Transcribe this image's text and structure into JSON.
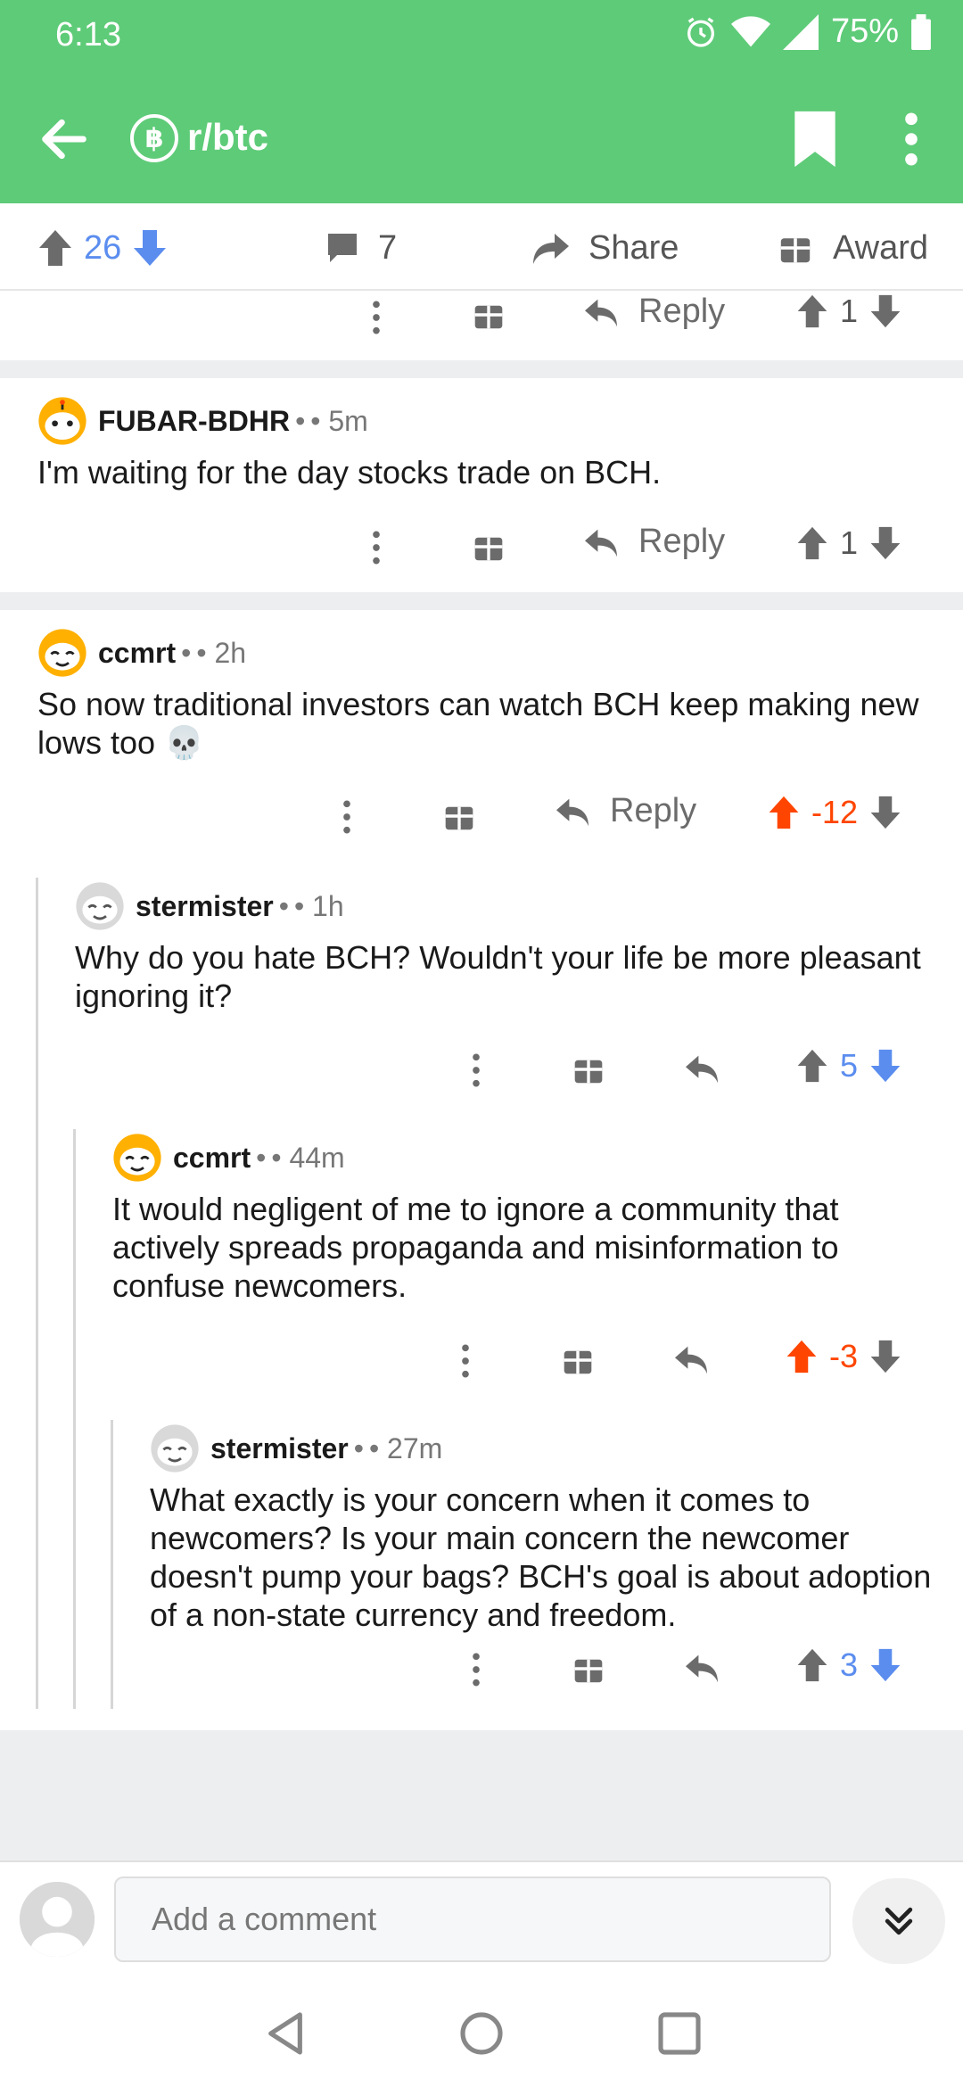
{
  "status": {
    "time": "6:13",
    "battery": "75%"
  },
  "header": {
    "subreddit": "r/btc",
    "sub_icon_glyph": "฿"
  },
  "post_actions": {
    "score": "26",
    "comments": "7",
    "share": "Share",
    "award": "Award"
  },
  "top_partial": {
    "reply": "Reply",
    "score": "1"
  },
  "comments": [
    {
      "author": "FUBAR-BDHR",
      "dot": "•",
      "time": "• 5m",
      "body": "I'm waiting for the day stocks trade on BCH.",
      "reply": "Reply",
      "score": "1",
      "vote_state": "none"
    },
    {
      "author": "ccmrt",
      "dot": "•",
      "time": "• 2h",
      "body": "So now traditional investors can watch BCH keep making new lows too 💀",
      "reply": "Reply",
      "score": "-12",
      "vote_state": "up"
    },
    {
      "author": "stermister",
      "dot": "•",
      "time": "• 1h",
      "body": "Why do you hate BCH? Wouldn't your life be more pleasant ignoring it?",
      "score": "5",
      "vote_state": "down"
    },
    {
      "author": "ccmrt",
      "dot": "•",
      "time": "• 44m",
      "body": "It would negligent of me to ignore a community that actively spreads propaganda and misinformation to confuse newcomers.",
      "score": "-3",
      "vote_state": "up"
    },
    {
      "author": "stermister",
      "dot": "•",
      "time": "• 27m",
      "body": "What exactly is your concern when it comes to newcomers? Is your main concern the newcomer doesn't pump your bags? BCH's goal is about adoption of a non-state currency and freedom.",
      "score": "3",
      "vote_state": "down"
    }
  ],
  "composer": {
    "placeholder": "Add a comment"
  },
  "colors": {
    "header": "#5ecb78",
    "upvote": "#ff4500",
    "downvote": "#5b8def",
    "icon_gray": "#6b6b6b"
  },
  "icons": [
    "back-arrow-icon",
    "bitcoin-icon",
    "bookmark-icon",
    "more-vertical-icon",
    "upvote-icon",
    "downvote-icon",
    "comment-icon",
    "share-icon",
    "gift-icon",
    "reply-icon",
    "chevrons-down-icon",
    "nav-back-icon",
    "nav-home-icon",
    "nav-recents-icon"
  ]
}
